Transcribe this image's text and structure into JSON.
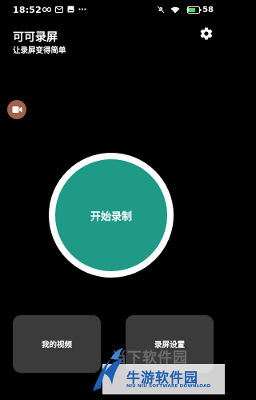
{
  "status_bar": {
    "time": "18:52",
    "left_icons": [
      "infinity-icon",
      "mail-icon",
      "image-icon",
      "more-dots-icon"
    ],
    "right_icons": [
      "mute-icon",
      "wifi-icon",
      "battery-saver-icon"
    ],
    "battery_percent": "58"
  },
  "header": {
    "title": "可可录屏",
    "subtitle": "让录屏变得简单",
    "settings_icon": "gear-icon"
  },
  "floating_button": {
    "icon": "video-camera-icon",
    "color": "#a0624a"
  },
  "main": {
    "record_label": "开始录制",
    "accent_color": "#1e9a86"
  },
  "bottom": {
    "my_videos_label": "我的视频",
    "settings_label": "录屏设置"
  },
  "watermark": {
    "site_text": "当下软件园",
    "brand_name": "牛游软件园",
    "brand_sub": "NIU NIU SOFTWARE DOWNLOAD",
    "brand_color": "#1d5fb3"
  }
}
